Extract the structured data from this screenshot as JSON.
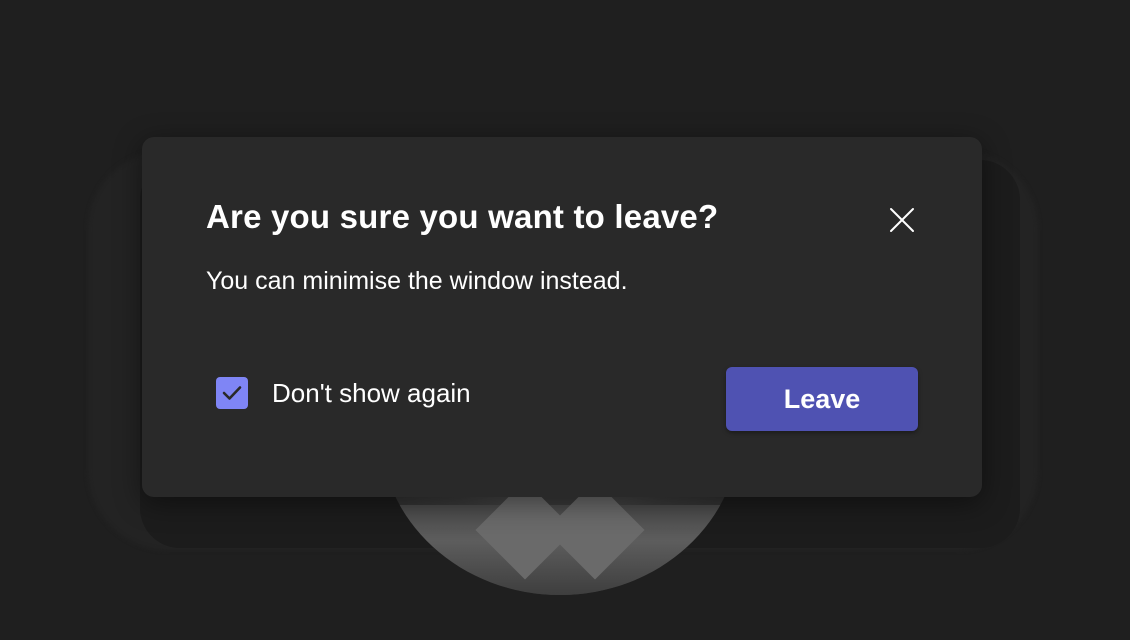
{
  "dialog": {
    "title": "Are you sure you want to leave?",
    "body": "You can minimise the window instead.",
    "close_icon": "close-icon",
    "checkbox": {
      "label": "Don't show again",
      "checked": true,
      "icon": "checkmark-icon"
    },
    "primary_button_label": "Leave"
  },
  "colors": {
    "background": "#1f1f1f",
    "dialog_background": "#292929",
    "accent": "#4f52b2",
    "checkbox_fill": "#7f85f5",
    "text": "#ffffff"
  }
}
